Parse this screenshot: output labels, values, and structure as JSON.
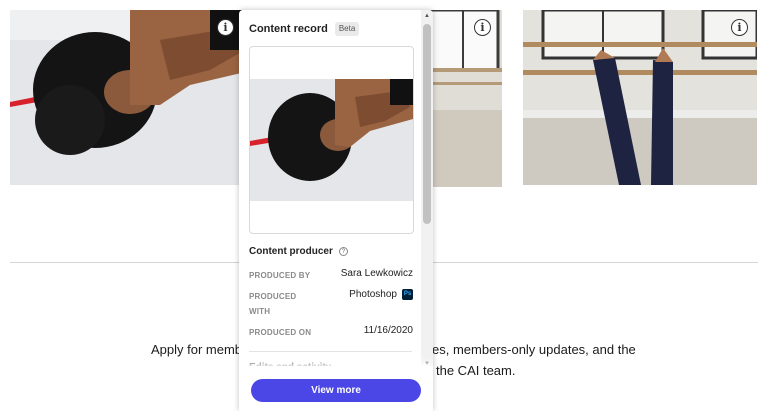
{
  "page": {
    "text_line1_left": "Apply for member",
    "text_line1_right": "es, members-only updates, and the",
    "text_line2": "the CAI team."
  },
  "gallery": {
    "icons": [
      "info-icon",
      "info-icon",
      "info-icon"
    ]
  },
  "panel": {
    "title": "Content record",
    "badge": "Beta",
    "producer_section": {
      "title": "Content producer",
      "help_icon": "?",
      "rows": [
        {
          "label": "PRODUCED BY",
          "value": "Sara Lewkowicz"
        },
        {
          "label": "PRODUCED WITH",
          "value": "Photoshop",
          "app_badge": "Ps"
        },
        {
          "label": "PRODUCED ON",
          "value": "11/16/2020"
        }
      ]
    },
    "next_section_title": "Edits and activity",
    "view_more_label": "View more"
  },
  "colors": {
    "accent": "#4b47e6",
    "photoshop_bg": "#001e36",
    "photoshop_fg": "#31a8ff"
  }
}
